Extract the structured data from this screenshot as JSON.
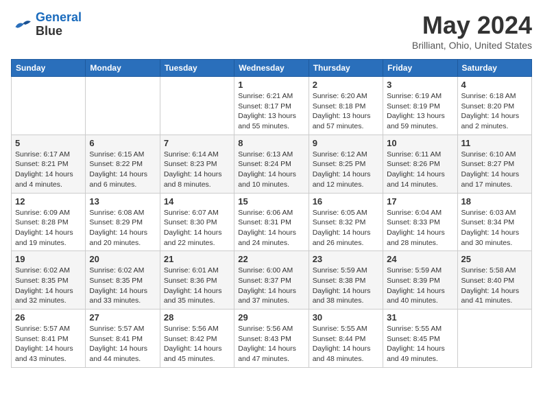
{
  "header": {
    "logo_line1": "General",
    "logo_line2": "Blue",
    "month": "May 2024",
    "location": "Brilliant, Ohio, United States"
  },
  "days_of_week": [
    "Sunday",
    "Monday",
    "Tuesday",
    "Wednesday",
    "Thursday",
    "Friday",
    "Saturday"
  ],
  "weeks": [
    [
      {
        "day": "",
        "sunrise": "",
        "sunset": "",
        "daylight": ""
      },
      {
        "day": "",
        "sunrise": "",
        "sunset": "",
        "daylight": ""
      },
      {
        "day": "",
        "sunrise": "",
        "sunset": "",
        "daylight": ""
      },
      {
        "day": "1",
        "sunrise": "Sunrise: 6:21 AM",
        "sunset": "Sunset: 8:17 PM",
        "daylight": "Daylight: 13 hours and 55 minutes."
      },
      {
        "day": "2",
        "sunrise": "Sunrise: 6:20 AM",
        "sunset": "Sunset: 8:18 PM",
        "daylight": "Daylight: 13 hours and 57 minutes."
      },
      {
        "day": "3",
        "sunrise": "Sunrise: 6:19 AM",
        "sunset": "Sunset: 8:19 PM",
        "daylight": "Daylight: 13 hours and 59 minutes."
      },
      {
        "day": "4",
        "sunrise": "Sunrise: 6:18 AM",
        "sunset": "Sunset: 8:20 PM",
        "daylight": "Daylight: 14 hours and 2 minutes."
      }
    ],
    [
      {
        "day": "5",
        "sunrise": "Sunrise: 6:17 AM",
        "sunset": "Sunset: 8:21 PM",
        "daylight": "Daylight: 14 hours and 4 minutes."
      },
      {
        "day": "6",
        "sunrise": "Sunrise: 6:15 AM",
        "sunset": "Sunset: 8:22 PM",
        "daylight": "Daylight: 14 hours and 6 minutes."
      },
      {
        "day": "7",
        "sunrise": "Sunrise: 6:14 AM",
        "sunset": "Sunset: 8:23 PM",
        "daylight": "Daylight: 14 hours and 8 minutes."
      },
      {
        "day": "8",
        "sunrise": "Sunrise: 6:13 AM",
        "sunset": "Sunset: 8:24 PM",
        "daylight": "Daylight: 14 hours and 10 minutes."
      },
      {
        "day": "9",
        "sunrise": "Sunrise: 6:12 AM",
        "sunset": "Sunset: 8:25 PM",
        "daylight": "Daylight: 14 hours and 12 minutes."
      },
      {
        "day": "10",
        "sunrise": "Sunrise: 6:11 AM",
        "sunset": "Sunset: 8:26 PM",
        "daylight": "Daylight: 14 hours and 14 minutes."
      },
      {
        "day": "11",
        "sunrise": "Sunrise: 6:10 AM",
        "sunset": "Sunset: 8:27 PM",
        "daylight": "Daylight: 14 hours and 17 minutes."
      }
    ],
    [
      {
        "day": "12",
        "sunrise": "Sunrise: 6:09 AM",
        "sunset": "Sunset: 8:28 PM",
        "daylight": "Daylight: 14 hours and 19 minutes."
      },
      {
        "day": "13",
        "sunrise": "Sunrise: 6:08 AM",
        "sunset": "Sunset: 8:29 PM",
        "daylight": "Daylight: 14 hours and 20 minutes."
      },
      {
        "day": "14",
        "sunrise": "Sunrise: 6:07 AM",
        "sunset": "Sunset: 8:30 PM",
        "daylight": "Daylight: 14 hours and 22 minutes."
      },
      {
        "day": "15",
        "sunrise": "Sunrise: 6:06 AM",
        "sunset": "Sunset: 8:31 PM",
        "daylight": "Daylight: 14 hours and 24 minutes."
      },
      {
        "day": "16",
        "sunrise": "Sunrise: 6:05 AM",
        "sunset": "Sunset: 8:32 PM",
        "daylight": "Daylight: 14 hours and 26 minutes."
      },
      {
        "day": "17",
        "sunrise": "Sunrise: 6:04 AM",
        "sunset": "Sunset: 8:33 PM",
        "daylight": "Daylight: 14 hours and 28 minutes."
      },
      {
        "day": "18",
        "sunrise": "Sunrise: 6:03 AM",
        "sunset": "Sunset: 8:34 PM",
        "daylight": "Daylight: 14 hours and 30 minutes."
      }
    ],
    [
      {
        "day": "19",
        "sunrise": "Sunrise: 6:02 AM",
        "sunset": "Sunset: 8:35 PM",
        "daylight": "Daylight: 14 hours and 32 minutes."
      },
      {
        "day": "20",
        "sunrise": "Sunrise: 6:02 AM",
        "sunset": "Sunset: 8:35 PM",
        "daylight": "Daylight: 14 hours and 33 minutes."
      },
      {
        "day": "21",
        "sunrise": "Sunrise: 6:01 AM",
        "sunset": "Sunset: 8:36 PM",
        "daylight": "Daylight: 14 hours and 35 minutes."
      },
      {
        "day": "22",
        "sunrise": "Sunrise: 6:00 AM",
        "sunset": "Sunset: 8:37 PM",
        "daylight": "Daylight: 14 hours and 37 minutes."
      },
      {
        "day": "23",
        "sunrise": "Sunrise: 5:59 AM",
        "sunset": "Sunset: 8:38 PM",
        "daylight": "Daylight: 14 hours and 38 minutes."
      },
      {
        "day": "24",
        "sunrise": "Sunrise: 5:59 AM",
        "sunset": "Sunset: 8:39 PM",
        "daylight": "Daylight: 14 hours and 40 minutes."
      },
      {
        "day": "25",
        "sunrise": "Sunrise: 5:58 AM",
        "sunset": "Sunset: 8:40 PM",
        "daylight": "Daylight: 14 hours and 41 minutes."
      }
    ],
    [
      {
        "day": "26",
        "sunrise": "Sunrise: 5:57 AM",
        "sunset": "Sunset: 8:41 PM",
        "daylight": "Daylight: 14 hours and 43 minutes."
      },
      {
        "day": "27",
        "sunrise": "Sunrise: 5:57 AM",
        "sunset": "Sunset: 8:41 PM",
        "daylight": "Daylight: 14 hours and 44 minutes."
      },
      {
        "day": "28",
        "sunrise": "Sunrise: 5:56 AM",
        "sunset": "Sunset: 8:42 PM",
        "daylight": "Daylight: 14 hours and 45 minutes."
      },
      {
        "day": "29",
        "sunrise": "Sunrise: 5:56 AM",
        "sunset": "Sunset: 8:43 PM",
        "daylight": "Daylight: 14 hours and 47 minutes."
      },
      {
        "day": "30",
        "sunrise": "Sunrise: 5:55 AM",
        "sunset": "Sunset: 8:44 PM",
        "daylight": "Daylight: 14 hours and 48 minutes."
      },
      {
        "day": "31",
        "sunrise": "Sunrise: 5:55 AM",
        "sunset": "Sunset: 8:45 PM",
        "daylight": "Daylight: 14 hours and 49 minutes."
      },
      {
        "day": "",
        "sunrise": "",
        "sunset": "",
        "daylight": ""
      }
    ]
  ]
}
